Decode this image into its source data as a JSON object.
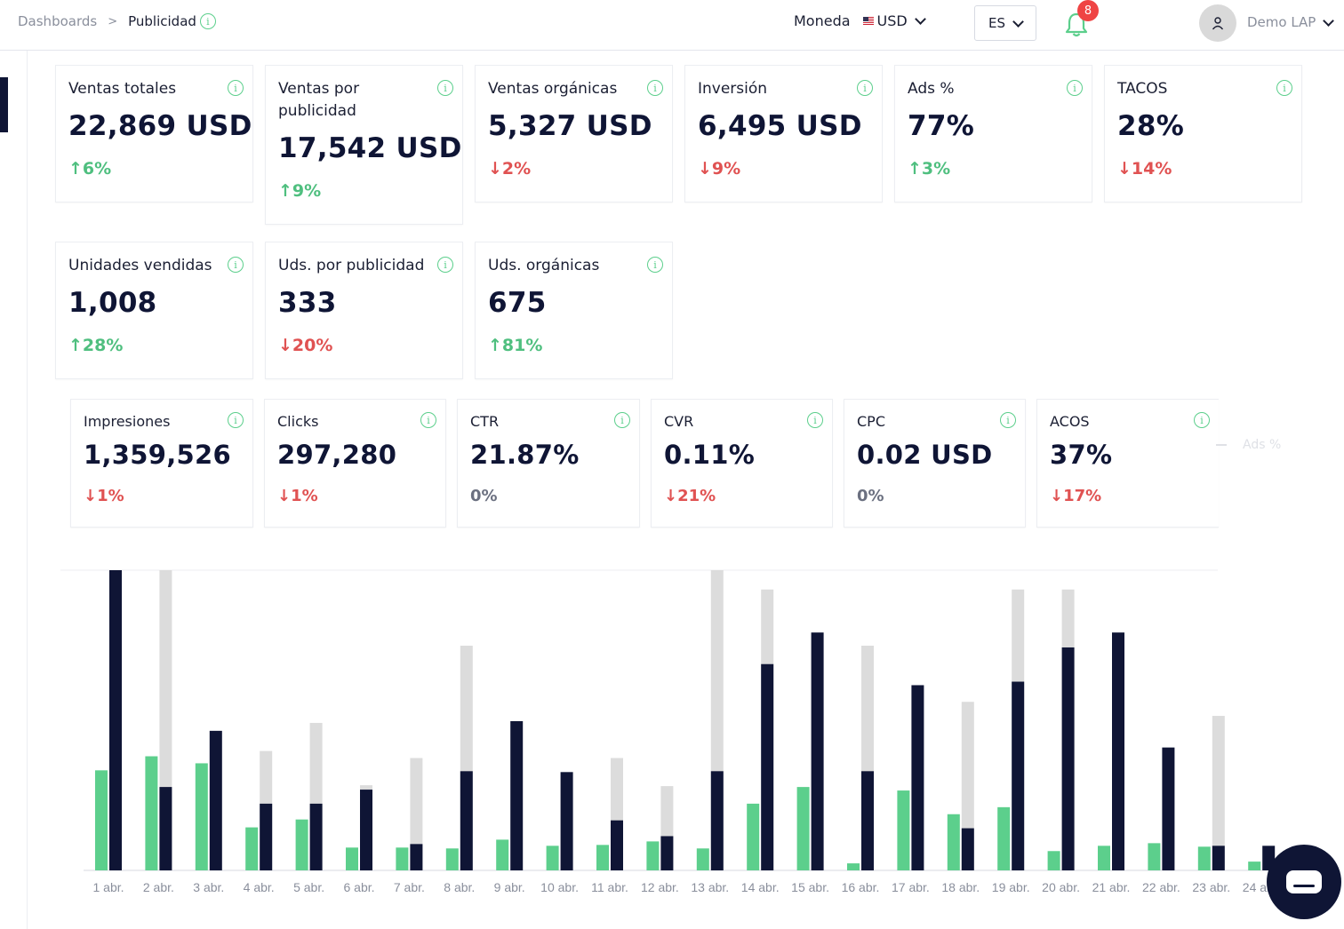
{
  "breadcrumb": {
    "root": "Dashboards",
    "separator": ">",
    "current": "Publicidad"
  },
  "currency": {
    "label": "Moneda",
    "value": "USD"
  },
  "language": {
    "value": "ES"
  },
  "notifications": {
    "count": "8"
  },
  "user": {
    "name": "Demo LAP"
  },
  "colors": {
    "accent_green": "#5ccf8c",
    "dark_navy": "#0f1535",
    "grey_bar": "#dcdcdc",
    "down_red": "#e05252",
    "up_green": "#4fbf7f"
  },
  "kpis_row1": [
    {
      "label": "Ventas totales",
      "value": "22,869 USD",
      "delta": "6%",
      "direction": "up"
    },
    {
      "label": "Ventas por publicidad",
      "value": "17,542 USD",
      "delta": "9%",
      "direction": "up"
    },
    {
      "label": "Ventas orgánicas",
      "value": "5,327 USD",
      "delta": "2%",
      "direction": "down"
    },
    {
      "label": "Inversión",
      "value": "6,495 USD",
      "delta": "9%",
      "direction": "down"
    },
    {
      "label": "Ads %",
      "value": "77%",
      "delta": "3%",
      "direction": "up"
    },
    {
      "label": "TACOS",
      "value": "28%",
      "delta": "14%",
      "direction": "down"
    }
  ],
  "kpis_row2": [
    {
      "label": "Unidades vendidas",
      "value": "1,008",
      "delta": "28%",
      "direction": "up"
    },
    {
      "label": "Uds. por publicidad",
      "value": "333",
      "delta": "20%",
      "direction": "down"
    },
    {
      "label": "Uds. orgánicas",
      "value": "675",
      "delta": "81%",
      "direction": "up"
    }
  ],
  "kpis_row3": [
    {
      "label": "Impresiones",
      "value": "1,359,526",
      "delta": "1%",
      "direction": "down"
    },
    {
      "label": "Clicks",
      "value": "297,280",
      "delta": "1%",
      "direction": "down"
    },
    {
      "label": "CTR",
      "value": "21.87%",
      "delta": "0%",
      "direction": "flat"
    },
    {
      "label": "CVR",
      "value": "0.11%",
      "delta": "21%",
      "direction": "down"
    },
    {
      "label": "CPC",
      "value": "0.02 USD",
      "delta": "0%",
      "direction": "flat"
    },
    {
      "label": "ACOS",
      "value": "37%",
      "delta": "17%",
      "direction": "down"
    }
  ],
  "legend_ghost": "Ads %",
  "chart_data": {
    "type": "bar",
    "categories": [
      "1 abr.",
      "2 abr.",
      "3 abr.",
      "4 abr.",
      "5 abr.",
      "6 abr.",
      "7 abr.",
      "8 abr.",
      "9 abr.",
      "10 abr.",
      "11 abr.",
      "12 abr.",
      "13 abr.",
      "14 abr.",
      "15 abr.",
      "16 abr.",
      "17 abr.",
      "18 abr.",
      "19 abr.",
      "20 abr.",
      "21 abr.",
      "22 abr.",
      "23 abr.",
      "24 abr."
    ],
    "series": [
      {
        "color": "#5ccf8c",
        "values": [
          114,
          130,
          122,
          49,
          58,
          26,
          26,
          25,
          35,
          28,
          29,
          33,
          25,
          76,
          95,
          8,
          91,
          64,
          72,
          22,
          28,
          31,
          27,
          10
        ]
      },
      {
        "color": "#0f1535",
        "values": [
          342,
          95,
          159,
          76,
          76,
          92,
          30,
          113,
          170,
          112,
          57,
          39,
          113,
          235,
          271,
          113,
          211,
          48,
          215,
          254,
          271,
          140,
          28,
          28
        ]
      },
      {
        "color": "#dcdcdc",
        "values": [
          0,
          342,
          0,
          136,
          168,
          97,
          128,
          256,
          0,
          0,
          128,
          96,
          342,
          320,
          0,
          256,
          0,
          192,
          320,
          320,
          0,
          0,
          176,
          0
        ]
      }
    ],
    "ylim": [
      0,
      342
    ],
    "grid": false,
    "legend": "top-right"
  }
}
